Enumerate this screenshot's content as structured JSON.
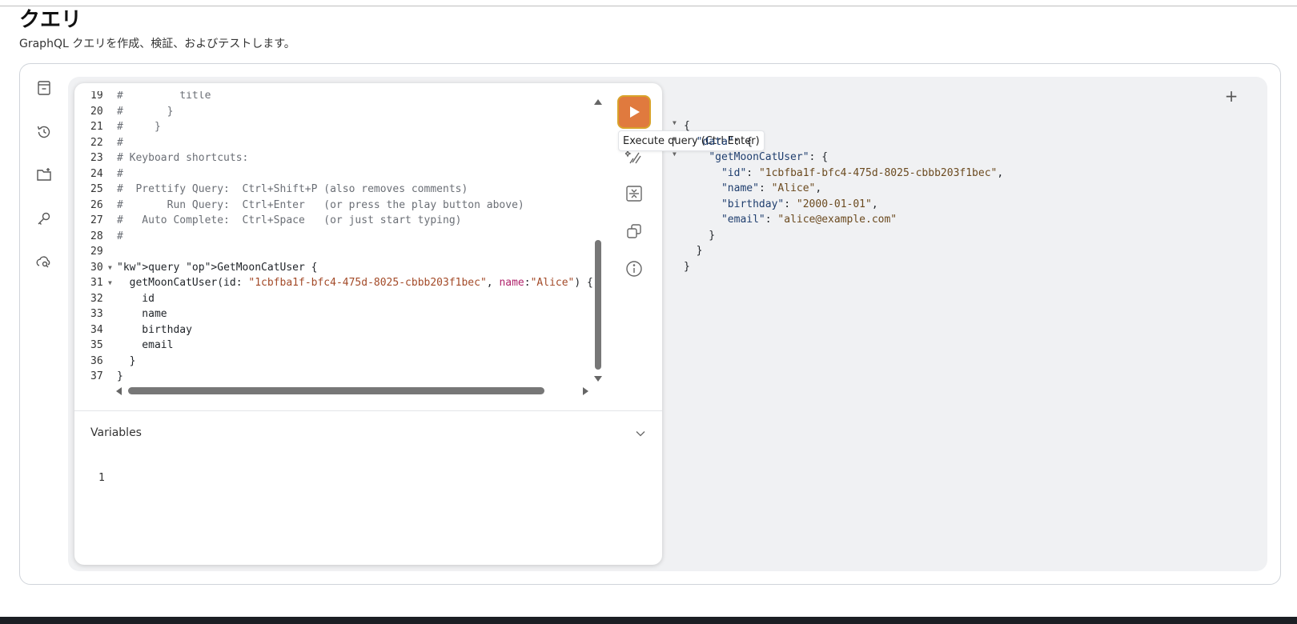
{
  "header": {
    "title": "クエリ",
    "subtitle": "GraphQL クエリを作成、検証、およびテストします。"
  },
  "sidebar": {
    "icons": [
      "docs-icon",
      "history-icon",
      "folder-add-icon",
      "key-icon",
      "explorer-icon"
    ]
  },
  "editor": {
    "lines": [
      {
        "n": "19",
        "text": "#         title"
      },
      {
        "n": "20",
        "text": "#       }"
      },
      {
        "n": "21",
        "text": "#     }"
      },
      {
        "n": "22",
        "text": "#"
      },
      {
        "n": "23",
        "text": "# Keyboard shortcuts:"
      },
      {
        "n": "24",
        "text": "#"
      },
      {
        "n": "25",
        "text": "#  Prettify Query:  Ctrl+Shift+P (also removes comments)"
      },
      {
        "n": "26",
        "text": "#       Run Query:  Ctrl+Enter   (or press the play button above)"
      },
      {
        "n": "27",
        "text": "#   Auto Complete:  Ctrl+Space   (or just start typing)"
      },
      {
        "n": "28",
        "text": "#"
      },
      {
        "n": "29",
        "text": ""
      },
      {
        "n": "30",
        "text": "query GetMoonCatUser {"
      },
      {
        "n": "31",
        "text": "  getMoonCatUser(id: \"1cbfba1f-bfc4-475d-8025-cbbb203f1bec\", name:\"Alice\") {"
      },
      {
        "n": "32",
        "text": "    id"
      },
      {
        "n": "33",
        "text": "    name"
      },
      {
        "n": "34",
        "text": "    birthday"
      },
      {
        "n": "35",
        "text": "    email"
      },
      {
        "n": "36",
        "text": "  }"
      },
      {
        "n": "37",
        "text": "}"
      }
    ]
  },
  "toolbar": {
    "run_tooltip": "Execute query (Ctrl-Enter)"
  },
  "variables": {
    "label": "Variables",
    "line_number": "1"
  },
  "result": {
    "lines": [
      "{",
      "  \"data\": {",
      "    \"getMoonCatUser\": {",
      "      \"id\": \"1cbfba1f-bfc4-475d-8025-cbbb203f1bec\",",
      "      \"name\": \"Alice\",",
      "      \"birthday\": \"2000-01-01\",",
      "      \"email\": \"alice@example.com\"",
      "    }",
      "  }",
      "}"
    ],
    "add_tab_label": "+"
  },
  "colors": {
    "run_button": "#e07a3e",
    "shell_bg": "#f0f1f3"
  }
}
